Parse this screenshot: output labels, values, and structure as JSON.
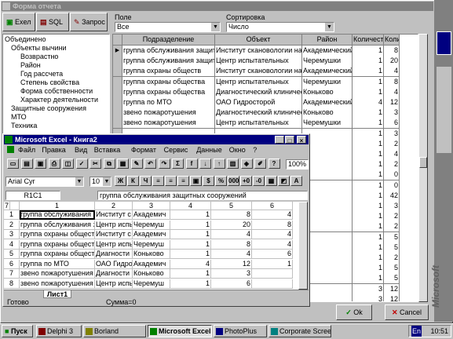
{
  "form": {
    "title": "Форма отчета",
    "toolbar": {
      "excel": "Exел",
      "sql": "SQL",
      "query": "Запрос"
    },
    "field_label": "Поле",
    "field_value": "Все",
    "sort_label": "Сортировка",
    "sort_value": "Число",
    "tree": [
      "Объединено",
      "Объекты вычини",
      "Возврастно",
      "Район",
      "Год рассчета",
      "Степень свойства",
      "Форма собственности",
      "Характер деятельности",
      "Защитные сооружения",
      "МТО",
      "Техника"
    ],
    "columns": [
      "Подразделение",
      "Объект",
      "Район",
      "Количество",
      "Количест"
    ],
    "rows": [
      [
        "группа обслуживания защит",
        "Институт скановологии на",
        "Академический",
        "1",
        "8"
      ],
      [
        "группа обслуживания защит",
        "Центр испытательных",
        "Черемушки",
        "1",
        "20"
      ],
      [
        "группа охраны обществ",
        "Институт скановологии на",
        "Академический",
        "1",
        "4"
      ],
      [
        "группа охраны общества",
        "Центр испытательных",
        "Черемушки",
        "1",
        "8"
      ],
      [
        "группа охраны общества",
        "Диагностический клинический",
        "Коньково",
        "1",
        "4"
      ],
      [
        "группа по МТО",
        "ОАО Гидросторой",
        "Академический",
        "4",
        "12"
      ],
      [
        "звено пожаротушения",
        "Диагностический клинический",
        "Коньково",
        "1",
        "3"
      ],
      [
        "звено пожаротушения",
        "Центр испытательных",
        "Черемушки",
        "1",
        "6"
      ],
      [
        "",
        "",
        "",
        "1",
        "3"
      ],
      [
        "",
        "",
        "",
        "1",
        "2"
      ],
      [
        "",
        "",
        "",
        "1",
        "4"
      ],
      [
        "",
        "",
        "",
        "1",
        "2"
      ],
      [
        "",
        "",
        "",
        "1",
        "0"
      ],
      [
        "",
        "",
        "",
        "1",
        "0"
      ],
      [
        "",
        "",
        "",
        "1",
        "42"
      ],
      [
        "",
        "",
        "",
        "1",
        "3"
      ],
      [
        "",
        "",
        "",
        "1",
        "2"
      ],
      [
        "",
        "",
        "",
        "1",
        "2"
      ],
      [
        "",
        "",
        "",
        "1",
        "5"
      ],
      [
        "",
        "",
        "",
        "1",
        "5"
      ],
      [
        "",
        "",
        "",
        "1",
        "2"
      ],
      [
        "",
        "",
        "",
        "1",
        "5"
      ],
      [
        "",
        "",
        "",
        "1",
        "5"
      ],
      [
        "",
        "",
        "",
        "3",
        "12"
      ],
      [
        "",
        "",
        "",
        "3",
        "12"
      ]
    ],
    "ok": "Ok",
    "cancel": "Cancel"
  },
  "excel": {
    "title": "Microsoft Excel - Книга2",
    "menu": [
      "Файл",
      "Правка",
      "Вид",
      "Вставка",
      "Формат",
      "Сервис",
      "Данные",
      "Окно",
      "?"
    ],
    "font": "Arial Cyr",
    "size": "10",
    "zoom": "100%",
    "cellref": "R1C1",
    "formula": "группа обслуживания защитных сооружений",
    "colhdr": [
      "1",
      "2",
      "3",
      "4",
      "5",
      "6",
      "7"
    ],
    "rows": [
      [
        "1",
        "группа обслуживания защ",
        "Институт с",
        "Академич",
        "1",
        "8",
        "4"
      ],
      [
        "2",
        "группа обслуживания защ",
        "Центр испы",
        "Черемуш",
        "1",
        "20",
        "8"
      ],
      [
        "3",
        "группа охраны общества",
        "Институт с",
        "Академич",
        "1",
        "4",
        "4"
      ],
      [
        "4",
        "группа охраны общества",
        "Центр испы",
        "Черемуш",
        "1",
        "8",
        "4"
      ],
      [
        "5",
        "группа охраны общества",
        "Диагности",
        "Коньково",
        "1",
        "4",
        "6"
      ],
      [
        "6",
        "группа по МТО",
        "ОАО Гидро",
        "Академич",
        "4",
        "12",
        "1"
      ],
      [
        "7",
        "звено пожаротушения",
        "Диагности",
        "Коньково",
        "1",
        "3",
        ""
      ],
      [
        "8",
        "звено пожаротушения",
        "Центр испы",
        "Черемуш",
        "1",
        "6",
        ""
      ]
    ],
    "sheet": "Лист1",
    "status": "Готово",
    "sum": "Сумма=0"
  },
  "taskbar": {
    "start": "Пуск",
    "items": [
      "Delphi 3",
      "Borland",
      "Microsoft Excel - ...",
      "PhotoPlus",
      "Corporate Screen"
    ],
    "lang": "En",
    "clock": "10:51"
  },
  "watermark": "Microsoft"
}
